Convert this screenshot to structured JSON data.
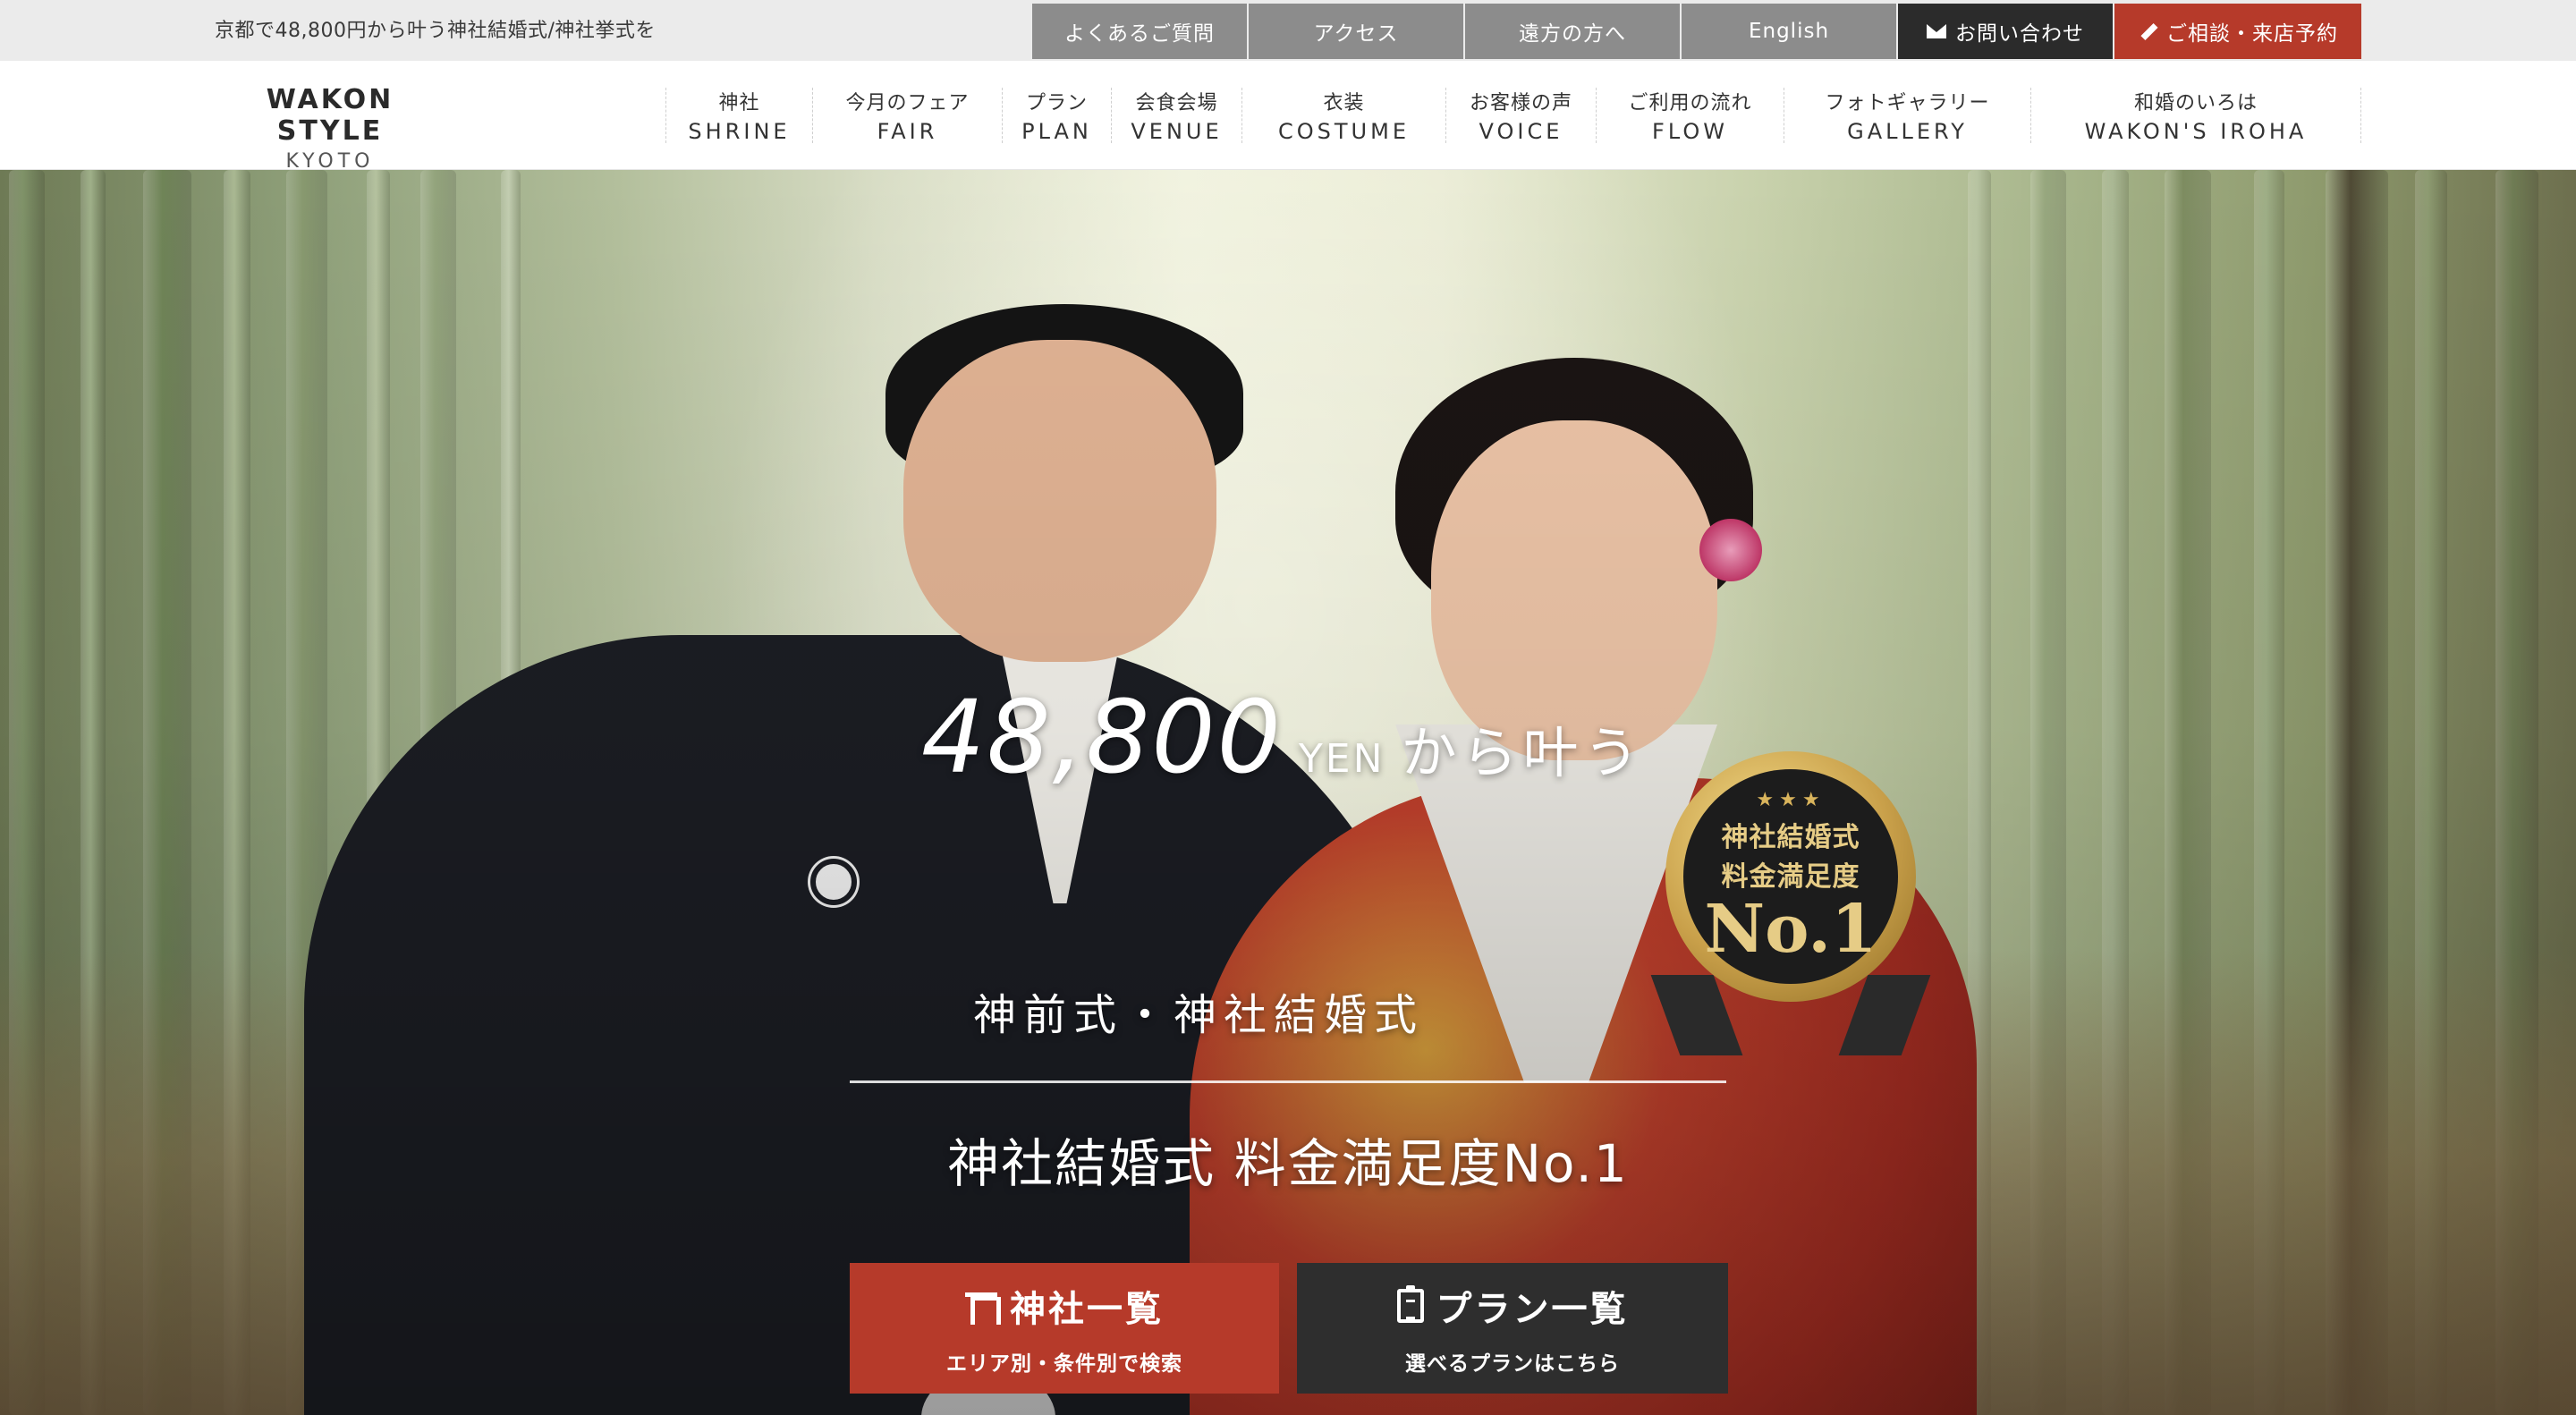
{
  "topbar": {
    "tagline": "京都で48,800円から叶う神社結婚式/神社挙式を",
    "links": [
      {
        "label": "よくあるご質問"
      },
      {
        "label": "アクセス"
      },
      {
        "label": "遠方の方へ"
      },
      {
        "label": "English"
      },
      {
        "label": "お問い合わせ",
        "icon": "mail-icon"
      },
      {
        "label": "ご相談・来店予約",
        "icon": "pencil-icon"
      }
    ]
  },
  "logo": {
    "main": "WAKON STYLE",
    "sub": "KYOTO"
  },
  "nav": [
    {
      "jp": "神社",
      "en": "SHRINE"
    },
    {
      "jp": "今月のフェア",
      "en": "FAIR"
    },
    {
      "jp": "プラン",
      "en": "PLAN"
    },
    {
      "jp": "会食会場",
      "en": "VENUE"
    },
    {
      "jp": "衣装",
      "en": "COSTUME"
    },
    {
      "jp": "お客様の声",
      "en": "VOICE"
    },
    {
      "jp": "ご利用の流れ",
      "en": "FLOW"
    },
    {
      "jp": "フォトギャラリー",
      "en": "GALLERY"
    },
    {
      "jp": "和婚のいろは",
      "en": "WAKON'S IROHA"
    }
  ],
  "hero": {
    "price": "48,800",
    "currency": "YEN",
    "suffix": "から叶う",
    "subtitle": "神前式・神社結婚式",
    "headline": "神社結婚式 料金満足度No.1",
    "badge": {
      "stars": "★★★",
      "line1": "神社結婚式",
      "line2": "料金満足度",
      "line3": "No.1"
    }
  },
  "cta": [
    {
      "title": "神社一覧",
      "sub": "エリア別・条件別で検索",
      "icon": "torii-icon"
    },
    {
      "title": "プラン一覧",
      "sub": "選べるプランはこちら",
      "icon": "clipboard-icon"
    }
  ],
  "colors": {
    "accent_red": "#b63a2a",
    "dark": "#2b2b2b",
    "gray": "#8c8c8c",
    "badge_gold": "#c9a04a"
  }
}
